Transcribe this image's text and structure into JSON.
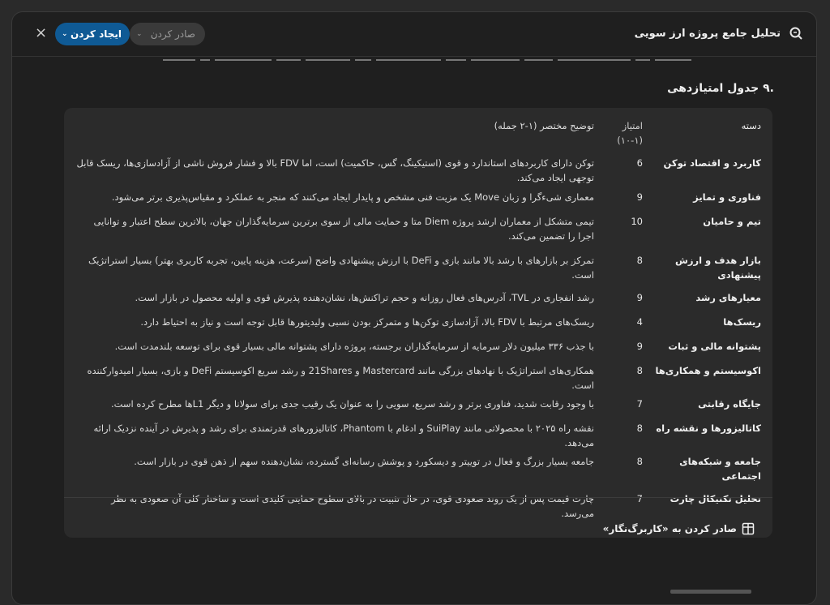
{
  "header": {
    "title": "تحلیل جامع پروژه ارز سویی",
    "icon": "search-doc-icon",
    "create_label": "ایجاد کردن",
    "export_label": "صادر کردن",
    "close_symbol": "×"
  },
  "section": {
    "title": ".۹ جدول امتیازدهی"
  },
  "table": {
    "headers": {
      "category": "دسته",
      "score": "امتیاز (۱-۱۰)",
      "desc": "توضیح مختصر (۱-۲ جمله)"
    },
    "rows": [
      {
        "category": "کاربرد و اقتصاد توکن",
        "score": "6",
        "desc": "توکن دارای کاربردهای استاندارد و قوی (استیکینگ، گس، حاکمیت) است، اما FDV بالا و فشار فروش ناشی از آزادسازی‌ها، ریسک قابل توجهی ایجاد می‌کند."
      },
      {
        "category": "فناوری و تمایز",
        "score": "9",
        "desc": "معماری شیءگرا و زبان Move یک مزیت فنی مشخص و پایدار ایجاد می‌کنند که منجر به عملکرد و مقیاس‌پذیری برتر می‌شود."
      },
      {
        "category": "تیم و حامیان",
        "score": "10",
        "desc": "تیمی متشکل از معماران ارشد پروژه Diem متا و حمایت مالی از سوی برترین سرمایه‌گذاران جهان، بالاترین سطح اعتبار و توانایی اجرا را تضمین می‌کند."
      },
      {
        "category": "بازار هدف و ارزش پیشنهادی",
        "score": "8",
        "desc": "تمرکز بر بازارهای با رشد بالا مانند بازی و DeFi با ارزش پیشنهادی واضح (سرعت، هزینه پایین، تجربه کاربری بهتر) بسیار استراتژیک است."
      },
      {
        "category": "معیارهای رشد",
        "score": "9",
        "desc": "رشد انفجاری در TVL، آدرس‌های فعال روزانه و حجم تراکنش‌ها، نشان‌دهنده پذیرش قوی و اولیه محصول در بازار است."
      },
      {
        "category": "ریسک‌ها",
        "score": "4",
        "desc": "ریسک‌های مرتبط با FDV بالا، آزادسازی توکن‌ها و متمرکز بودن نسبی ولیدیتورها قابل توجه است و نیاز به احتیاط دارد."
      },
      {
        "category": "پشتوانه مالی و ثبات",
        "score": "9",
        "desc": "با جذب ۳۳۶ میلیون دلار سرمایه از سرمایه‌گذاران برجسته، پروژه دارای پشتوانه مالی بسیار قوی برای توسعه بلندمدت است."
      },
      {
        "category": "اکوسیستم و همکاری‌ها",
        "score": "8",
        "desc": "همکاری‌های استراتژیک با نهادهای بزرگی مانند Mastercard و 21Shares و رشد سریع اکوسیستم DeFi و بازی، بسیار امیدوارکننده است."
      },
      {
        "category": "جایگاه رقابتی",
        "score": "7",
        "desc": "با وجود رقابت شدید، فناوری برتر و رشد سریع، سویی را به عنوان یک رقیب جدی برای سولانا و دیگر L1ها مطرح کرده است."
      },
      {
        "category": "کاتالیزورها و نقشه راه",
        "score": "8",
        "desc": "نقشه راه ۲۰۲۵ با محصولاتی مانند SuiPlay و ادغام با Phantom، کاتالیزورهای قدرتمندی برای رشد و پذیرش در آینده نزدیک ارائه می‌دهد."
      },
      {
        "category": "جامعه و شبکه‌های اجتماعی",
        "score": "8",
        "desc": "جامعه بسیار بزرگ و فعال در توییتر و دیسکورد و پوشش رسانه‌ای گسترده، نشان‌دهنده سهم از ذهن قوی در بازار است."
      },
      {
        "category": "تحلیل تکنیکال چارت",
        "score": "7",
        "desc": "چارت قیمت پس از یک روند صعودی قوی، در حال تثبیت در بالای سطوح حمایتی کلیدی است و ساختار کلی آن صعودی به نظر می‌رسد."
      }
    ],
    "export_sheets_label": "صادر کردن به «کاربرگ‌نگار»"
  }
}
